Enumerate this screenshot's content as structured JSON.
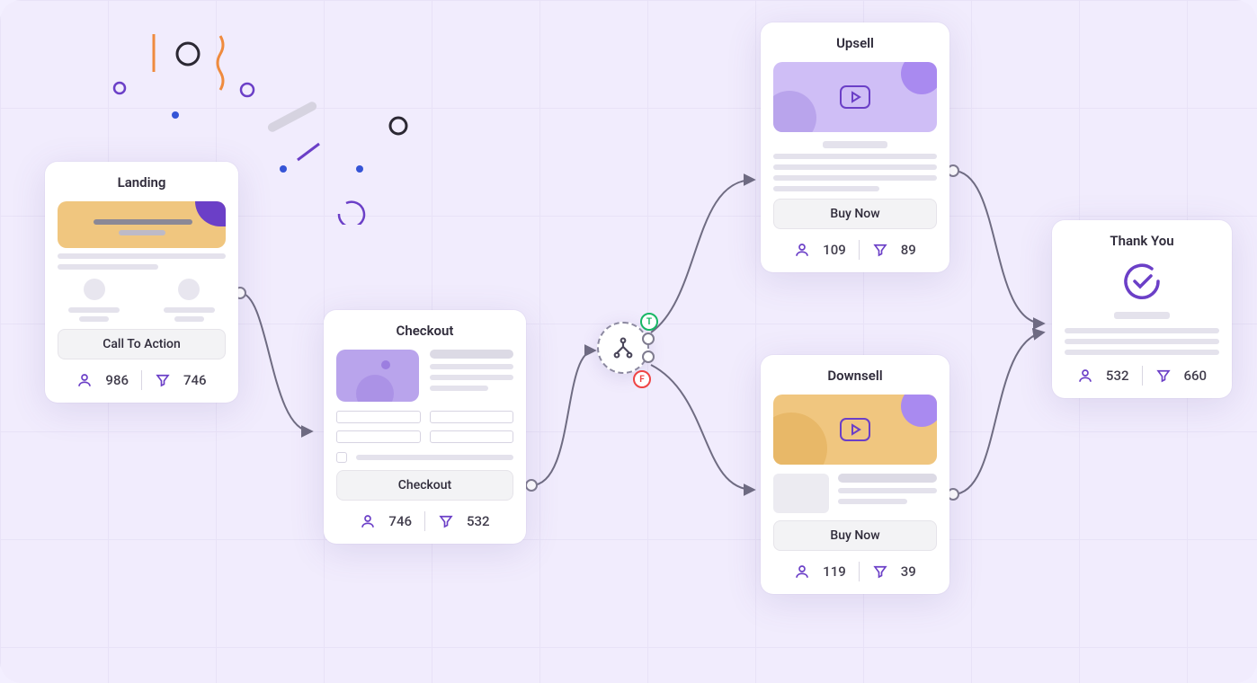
{
  "nodes": {
    "landing": {
      "title": "Landing",
      "cta": "Call To Action",
      "visitors": 986,
      "filtered": 746
    },
    "checkout": {
      "title": "Checkout",
      "cta": "Checkout",
      "visitors": 746,
      "filtered": 532
    },
    "upsell": {
      "title": "Upsell",
      "cta": "Buy Now",
      "visitors": 109,
      "filtered": 89
    },
    "downsell": {
      "title": "Downsell",
      "cta": "Buy Now",
      "visitors": 119,
      "filtered": 39
    },
    "thankyou": {
      "title": "Thank You",
      "visitors": 532,
      "filtered": 660
    }
  },
  "decision": {
    "true_label": "T",
    "false_label": "F"
  }
}
